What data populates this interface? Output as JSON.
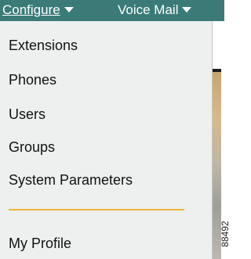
{
  "menubar": {
    "configure_label": "Configure",
    "voicemail_label": "Voice Mail",
    "color": "#3a7b78"
  },
  "dropdown": {
    "items": [
      "Extensions",
      "Phones",
      "Users",
      "Groups",
      "System Parameters"
    ],
    "footer_item": "My Profile",
    "separator_color": "#f0b43a"
  },
  "figure_number": "88492"
}
